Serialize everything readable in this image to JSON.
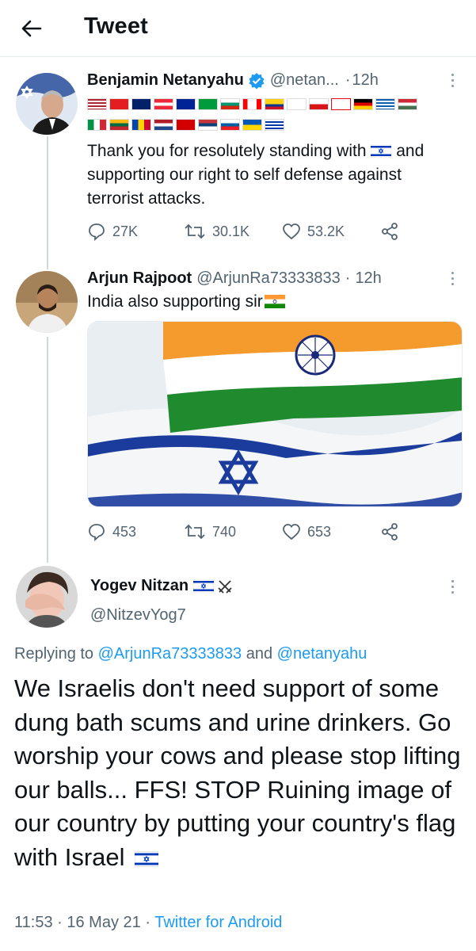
{
  "header": {
    "title": "Tweet",
    "back_icon": "arrow-left-icon"
  },
  "tweet1": {
    "name": "Benjamin Netanyahu",
    "verified_icon": "verified-badge-icon",
    "handle": "@netan...",
    "dot": "·",
    "time": "12h",
    "text": "Thank you for resolutely standing with",
    "text2": "and supporting our right to self defense against terrorist attacks.",
    "stats": {
      "replies": "27K",
      "retweets": "30.1K",
      "likes": "53.2K"
    }
  },
  "tweet2": {
    "name": "Arjun Rajpoot",
    "handle": "@ArjunRa73333833",
    "dot": "·",
    "time": "12h",
    "text": "India also supporting sir",
    "stats": {
      "replies": "453",
      "retweets": "740",
      "likes": "653"
    }
  },
  "tweet3": {
    "name": "Yogev Nitzan",
    "handle": "@NitzevYog7",
    "reply_prefix": "Replying to",
    "reply_user1": "@ArjunRa73333833",
    "reply_and": "and",
    "reply_user2": "@netanyahu",
    "text": "We Israelis don't need support of some dung bath scums and urine drinkers. Go worship your cows and please stop lifting our balls... FFS! STOP Ruining image of our country by putting your country's flag with Israel",
    "footer_time": "11:53",
    "footer_dot1": "·",
    "footer_date": "16 May 21",
    "footer_dot2": "·",
    "footer_source": "Twitter for Android"
  },
  "colors": {
    "accent": "#1d9bf0",
    "secondary_text": "#536471",
    "verified": "#1d9bf0"
  }
}
